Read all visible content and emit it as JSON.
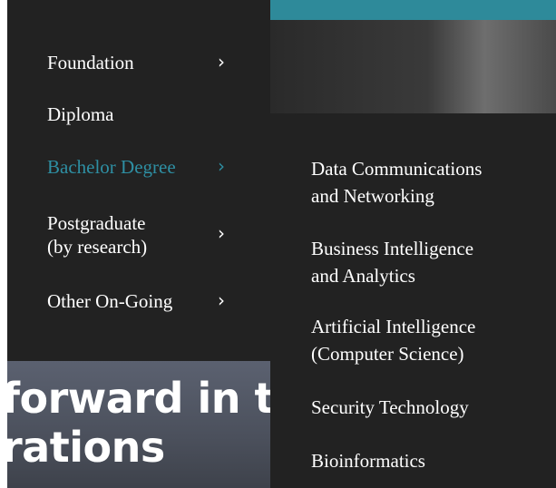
{
  "hero": {
    "line1": "forward in t",
    "line2": "rations"
  },
  "menu": {
    "items": [
      {
        "label": "Foundation",
        "has_children": true,
        "active": false
      },
      {
        "label": "Diploma",
        "has_children": false,
        "active": false
      },
      {
        "label": "Bachelor Degree",
        "has_children": true,
        "active": true
      },
      {
        "label_line1": "Postgraduate",
        "label_line2": "(by research)",
        "has_children": true,
        "active": false
      },
      {
        "label": "Other On-Going",
        "has_children": true,
        "active": false
      }
    ],
    "chevron": "›"
  },
  "submenu": {
    "items": [
      {
        "label_line1": "Data Communications",
        "label_line2": "and Networking"
      },
      {
        "label_line1": "Business Intelligence",
        "label_line2": "and Analytics"
      },
      {
        "label_line1": "Artificial Intelligence",
        "label_line2": "(Computer Science)"
      },
      {
        "label": "Security Technology"
      },
      {
        "label": "Bioinformatics"
      }
    ]
  },
  "colors": {
    "panel_bg": "#222222",
    "accent": "#2e8fa3",
    "text": "#ffffff"
  }
}
